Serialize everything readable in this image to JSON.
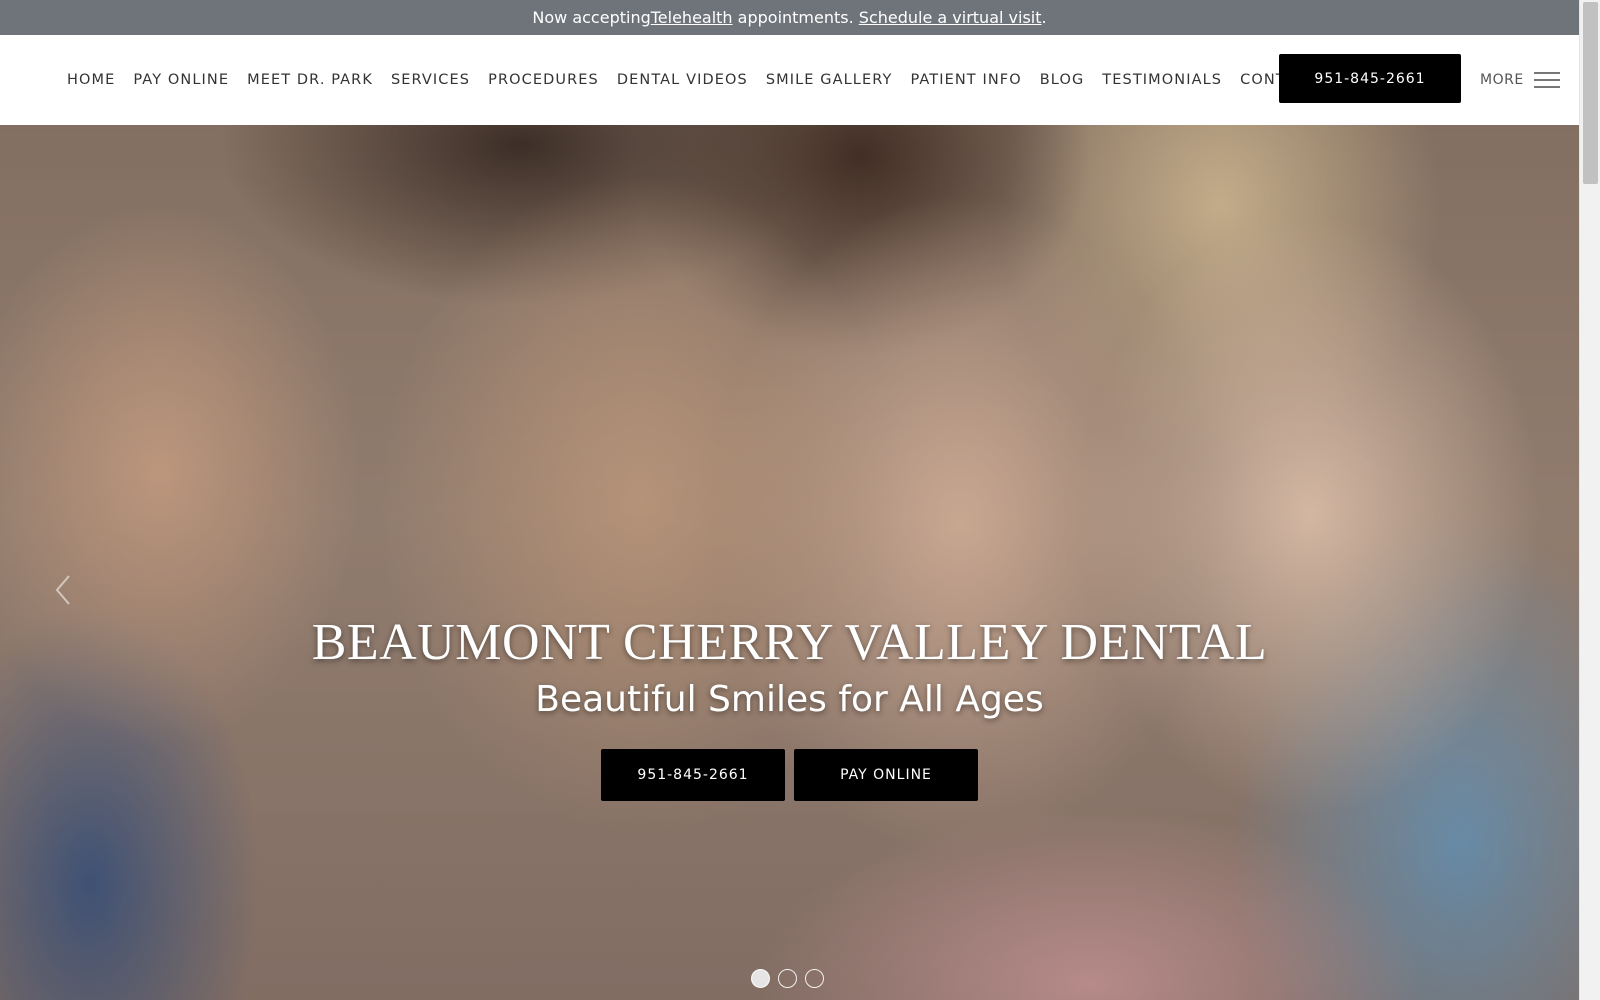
{
  "announcement": {
    "prefix": "Now accepting ",
    "telehealth_link": "Telehealth",
    "middle": " appointments. ",
    "schedule_link": "Schedule a virtual visit",
    "suffix": "."
  },
  "nav": {
    "items": [
      {
        "label": "HOME"
      },
      {
        "label": "PAY ONLINE"
      },
      {
        "label": "MEET DR. PARK"
      },
      {
        "label": "SERVICES"
      },
      {
        "label": "PROCEDURES"
      },
      {
        "label": "DENTAL VIDEOS"
      },
      {
        "label": "SMILE GALLERY"
      },
      {
        "label": "PATIENT INFO"
      },
      {
        "label": "BLOG"
      },
      {
        "label": "TESTIMONIALS"
      },
      {
        "label": "CONTACT"
      }
    ],
    "phone_button": "951-845-2661",
    "more_label": "MORE"
  },
  "hero": {
    "title": "BEAUMONT CHERRY VALLEY DENTAL",
    "subtitle": "Beautiful Smiles for All Ages",
    "phone_button": "951-845-2661",
    "pay_button": "PAY ONLINE",
    "slides_count": 3,
    "active_slide": 1
  },
  "colors": {
    "announcement_bg": "#6f747b",
    "button_bg": "#000000",
    "nav_text": "#333333"
  }
}
